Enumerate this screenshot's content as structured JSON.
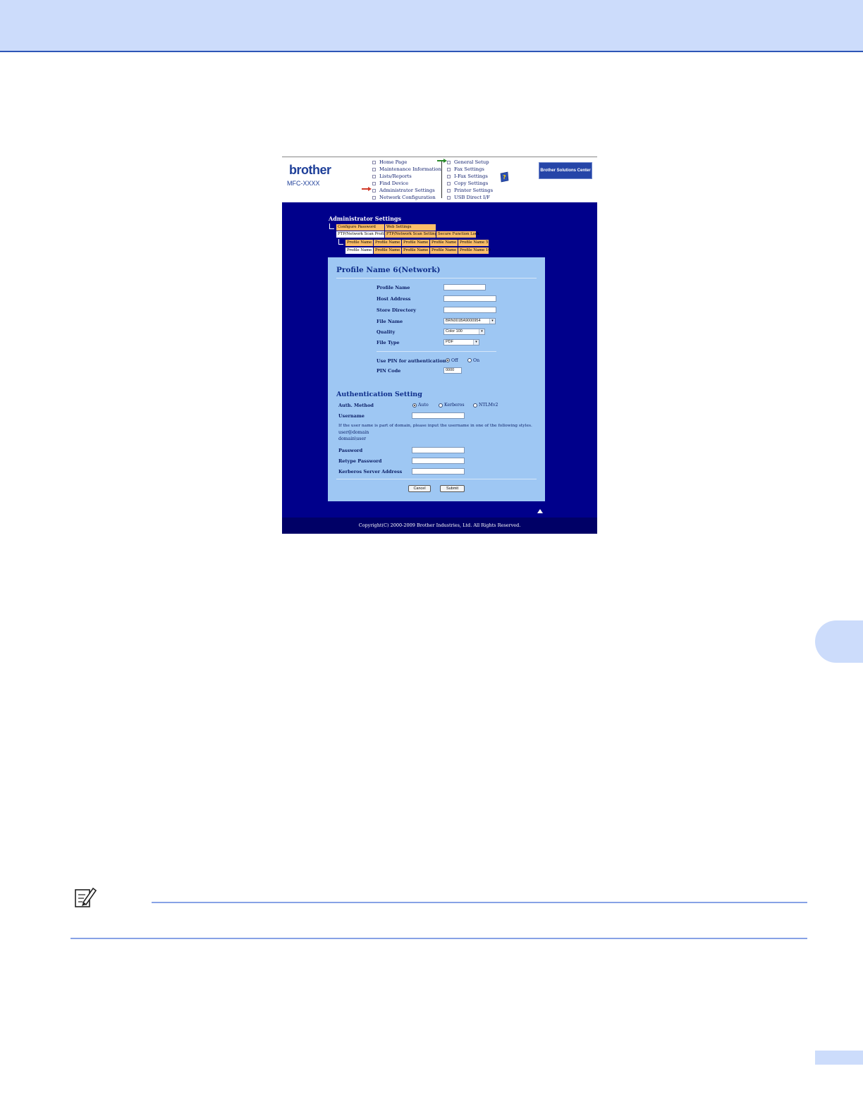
{
  "header": {
    "brand": "brother",
    "model": "MFC-XXXX",
    "nav_left": [
      "Home Page",
      "Maintenance Information",
      "Lists/Reports",
      "Find Device",
      "Administrator Settings",
      "Network Configuration"
    ],
    "nav_right": [
      "General Setup",
      "Fax Settings",
      "I-Fax Settings",
      "Copy Settings",
      "Printer Settings",
      "USB Direct I/F"
    ],
    "solutions_button": "Brother Solutions Center"
  },
  "admin": {
    "title": "Administrator Settings",
    "tabs_row1": [
      "Configure Password",
      "Web Settings"
    ],
    "tabs_row2": [
      "FTP/Network Scan Profile",
      "FTP/Network Scan Settings",
      "Secure Function Lock"
    ],
    "profile_tabs_row1": [
      "Profile Name 1",
      "Profile Name 2",
      "Profile Name 3",
      "Profile Name 4",
      "Profile Name 5"
    ],
    "profile_tabs_row2": [
      "Profile Name 6",
      "Profile Name 7",
      "Profile Name 8",
      "Profile Name 9",
      "Profile Name 10"
    ]
  },
  "form": {
    "title": "Profile Name 6(Network)",
    "profile_name_label": "Profile Name",
    "host_address_label": "Host Address",
    "store_directory_label": "Store Directory",
    "file_name_label": "File Name",
    "file_name_value": "BRN001BA9000954",
    "quality_label": "Quality",
    "quality_value": "Color 100",
    "file_type_label": "File Type",
    "file_type_value": "PDF",
    "use_pin_label": "Use PIN for authentication",
    "pin_off": "Off",
    "pin_on": "On",
    "pin_code_label": "PIN Code",
    "pin_code_value": "0000"
  },
  "auth": {
    "title": "Authentication Setting",
    "method_label": "Auth. Method",
    "method_options": [
      "Auto",
      "Kerberos",
      "NTLMv2"
    ],
    "username_label": "Username",
    "hint": "If the user name is part of domain, please input the username in one of the following styles.",
    "hint_style1": "user@domain",
    "hint_style2": "domain\\user",
    "password_label": "Password",
    "retype_password_label": "Retype Password",
    "kerberos_label": "Kerberos Server Address"
  },
  "buttons": {
    "cancel": "Cancel",
    "submit": "Submit"
  },
  "footer": "Copyright(C) 2000-2009 Brother Industries, Ltd. All Rights Reserved."
}
